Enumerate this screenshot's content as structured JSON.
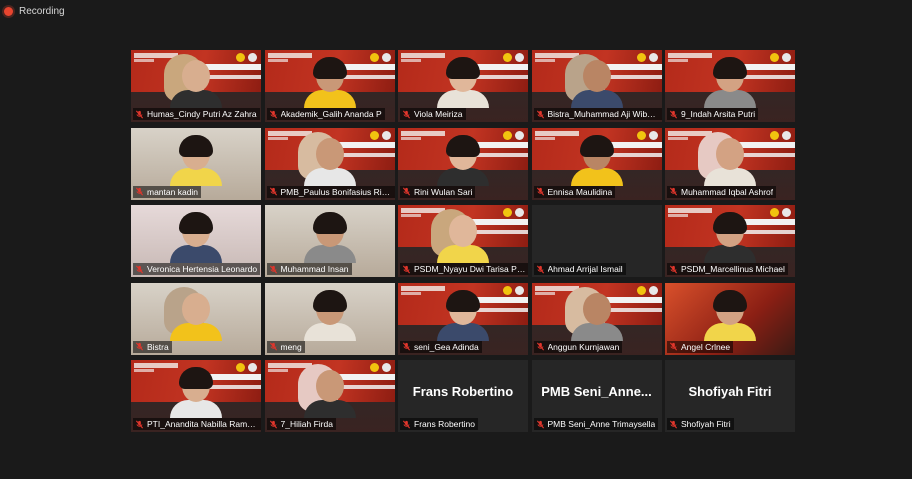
{
  "recording": {
    "label": "Recording",
    "color": "#e8452f"
  },
  "theme": {
    "accent_red": "#c23422",
    "muted_mic": "#e0362c"
  },
  "participants": [
    {
      "name": "Humas_Cindy Putri Az Zahra",
      "bg": "fgd",
      "muted": true
    },
    {
      "name": "Akademik_Galih Ananda P",
      "bg": "fgd",
      "muted": true
    },
    {
      "name": "Viola Meiriza",
      "bg": "fgd",
      "muted": true
    },
    {
      "name": "Bistra_Muhammad Aji Wibowo",
      "bg": "fgd",
      "muted": true
    },
    {
      "name": "9_Indah Arsita Putri",
      "bg": "fgd",
      "muted": true
    },
    {
      "name": "mantan kadin",
      "bg": "room",
      "muted": true
    },
    {
      "name": "PMB_Paulus Bonifasius Ricky",
      "bg": "fgd",
      "muted": true
    },
    {
      "name": "Rini Wulan Sari",
      "bg": "fgd",
      "muted": true
    },
    {
      "name": "Ennisa Maulidina",
      "bg": "fgd",
      "muted": true
    },
    {
      "name": "Muhammad Iqbal Ashrof",
      "bg": "fgd",
      "muted": true
    },
    {
      "name": "Veronica Hertensia Leonardo",
      "bg": "pink",
      "muted": true
    },
    {
      "name": "Muhammad Insan",
      "bg": "room",
      "muted": true
    },
    {
      "name": "PSDM_Nyayu Dwi Tarisa Putri",
      "bg": "fgd",
      "muted": true
    },
    {
      "name": "Ahmad Arrijal Ismail",
      "bg": "dark",
      "muted": true
    },
    {
      "name": "PSDM_Marcellinus Michael",
      "bg": "fgd",
      "muted": true
    },
    {
      "name": "Bistra",
      "bg": "room",
      "muted": true
    },
    {
      "name": "meng",
      "bg": "room",
      "muted": true
    },
    {
      "name": "seni_Gea Adinda",
      "bg": "fgd",
      "muted": true
    },
    {
      "name": "Anggun Kurnjawan",
      "bg": "fgd",
      "muted": true
    },
    {
      "name": "Angel Crlnee",
      "bg": "fire",
      "muted": true
    },
    {
      "name": "PTI_Anandita Nabilla Ramadhani",
      "bg": "fgd",
      "muted": true
    },
    {
      "name": "7_Hiliah Firda",
      "bg": "fgd",
      "muted": true
    },
    {
      "name": "Frans Robertino",
      "bg": "dark",
      "muted": true,
      "display_name": "Frans Robertino"
    },
    {
      "name": "PMB Seni_Anne Trimaysella",
      "bg": "dark",
      "muted": true,
      "display_name": "PMB  Seni_Anne..."
    },
    {
      "name": "Shofiyah Fitri",
      "bg": "dark",
      "muted": true,
      "display_name": "Shofiyah Fitri"
    }
  ]
}
